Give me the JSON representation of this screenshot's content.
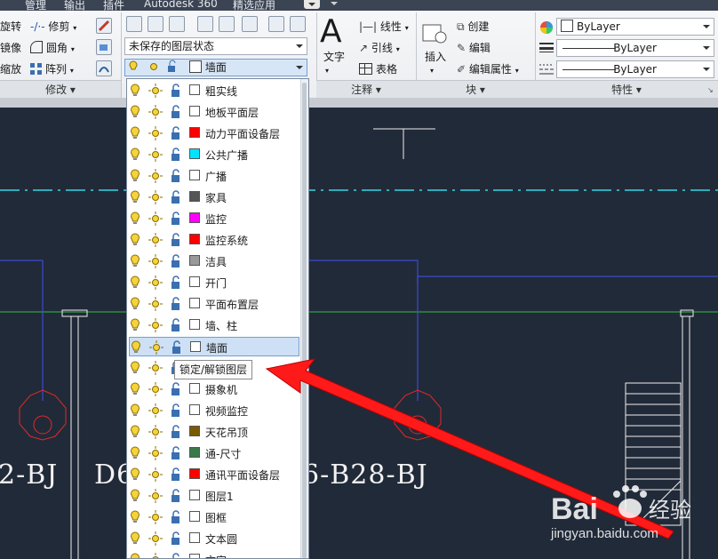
{
  "menubar": {
    "items": [
      "管理",
      "输出",
      "插件",
      "Autodesk 360",
      "精选应用"
    ]
  },
  "modify_panel": {
    "title": "修改",
    "rows": [
      {
        "left": "旋转",
        "right": "修剪"
      },
      {
        "left": "镜像",
        "right": "圆角"
      },
      {
        "left": "缩放",
        "right": "阵列"
      }
    ]
  },
  "layers_panel": {
    "state_combo": "未保存的图层状态",
    "current_layer": "墙面"
  },
  "annotation_panel": {
    "title": "注释",
    "big_button": "文字",
    "items": [
      "线性",
      "引线",
      "表格"
    ]
  },
  "block_panel": {
    "title": "块",
    "big_button": "插入",
    "items": [
      "创建",
      "编辑",
      "编辑属性"
    ]
  },
  "properties_panel": {
    "title": "特性",
    "color": "ByLayer",
    "linetype": "ByLayer",
    "lineweight": "ByLayer"
  },
  "layer_list": [
    {
      "name": "粗实线",
      "color": "#ffffff"
    },
    {
      "name": "地板平面层",
      "color": "#ffffff"
    },
    {
      "name": "动力平面设备层",
      "color": "#ff0000"
    },
    {
      "name": "公共广播",
      "color": "#00e5ff"
    },
    {
      "name": "广播",
      "color": "#ffffff"
    },
    {
      "name": "家具",
      "color": "#555555"
    },
    {
      "name": "监控",
      "color": "#ff00ff"
    },
    {
      "name": "监控系统",
      "color": "#ff0000"
    },
    {
      "name": "洁具",
      "color": "#999999"
    },
    {
      "name": "开门",
      "color": "#ffffff"
    },
    {
      "name": "平面布置层",
      "color": "#ffffff"
    },
    {
      "name": "墙、柱",
      "color": "#ffffff"
    },
    {
      "name": "墙面",
      "color": "#ffffff",
      "selected": true
    },
    {
      "name": "",
      "color": "#ffffff"
    },
    {
      "name": "摄象机",
      "color": "#ffffff"
    },
    {
      "name": "视频监控",
      "color": "#ffffff"
    },
    {
      "name": "天花吊顶",
      "color": "#7a5a00"
    },
    {
      "name": "通-尺寸",
      "color": "#3a7a4a"
    },
    {
      "name": "通讯平面设备层",
      "color": "#ff0000"
    },
    {
      "name": "图层1",
      "color": "#ffffff"
    },
    {
      "name": "图框",
      "color": "#ffffff"
    },
    {
      "name": "文本圆",
      "color": "#ffffff"
    },
    {
      "name": "文字",
      "color": "#ffffff"
    }
  ],
  "tooltip": "锁定/解锁图层",
  "drawing_labels": [
    "2-BJ",
    "D6",
    "6-B28-BJ"
  ],
  "watermark": {
    "brand": "Bai  经验",
    "url": "jingyan.baidu.com"
  },
  "colors": {
    "accent_blue": "#6f9fd6",
    "arrow_red": "#ff1a1a",
    "cad_bg": "#212a38"
  }
}
